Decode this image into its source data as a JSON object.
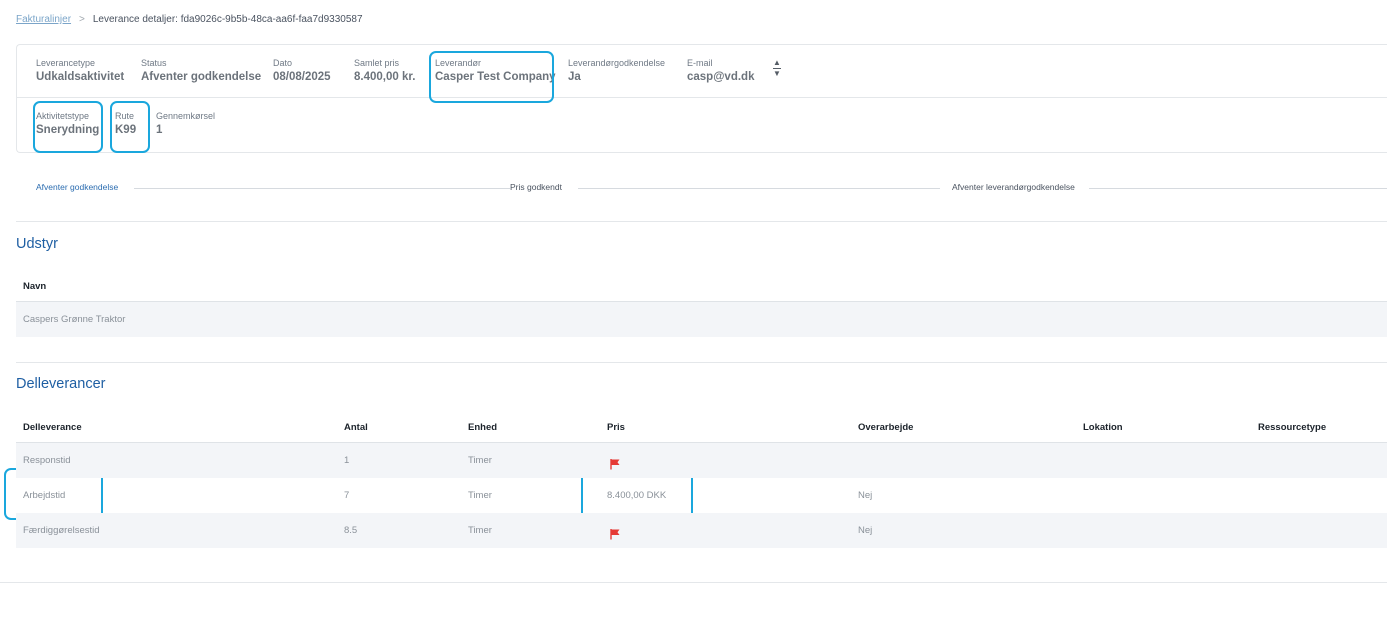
{
  "breadcrumb": {
    "link": "Fakturalinjer",
    "separator": ">",
    "current": "Leverance detaljer: fda9026c-9b5b-48ca-aa6f-faa7d9330587"
  },
  "info": {
    "leverancetype": {
      "label": "Leverancetype",
      "value": "Udkaldsaktivitet"
    },
    "status": {
      "label": "Status",
      "value": "Afventer godkendelse"
    },
    "dato": {
      "label": "Dato",
      "value": "08/08/2025"
    },
    "samlet_pris": {
      "label": "Samlet pris",
      "value": "8.400,00 kr."
    },
    "leverandor": {
      "label": "Leverandør",
      "value": "Casper Test Company"
    },
    "leverandorgodkendelse": {
      "label": "Leverandørgodkendelse",
      "value": "Ja"
    },
    "email": {
      "label": "E-mail",
      "value": "casp@vd.dk"
    },
    "aktivitetstype": {
      "label": "Aktivitetstype",
      "value": "Snerydning"
    },
    "rute": {
      "label": "Rute",
      "value": "K99"
    },
    "gennemkorsel": {
      "label": "Gennemkørsel",
      "value": "1"
    }
  },
  "steps": [
    {
      "label": "Afventer godkendelse",
      "active": true
    },
    {
      "label": "Pris godkendt",
      "active": false
    },
    {
      "label": "Afventer leverandørgodkendelse",
      "active": false
    }
  ],
  "udstyr": {
    "title": "Udstyr",
    "column": "Navn",
    "rows": [
      "Caspers Grønne Traktor"
    ]
  },
  "delleverancer": {
    "title": "Delleverancer",
    "columns": {
      "delleverance": "Delleverance",
      "antal": "Antal",
      "enhed": "Enhed",
      "pris": "Pris",
      "overarbejde": "Overarbejde",
      "lokation": "Lokation",
      "ressourcetype": "Ressourcetype"
    },
    "rows": [
      {
        "delleverance": "Responstid",
        "antal": "1",
        "enhed": "Timer",
        "pris": "",
        "pris_icon": "red-flag-icon",
        "overarbejde": "",
        "lokation": "",
        "ressourcetype": ""
      },
      {
        "delleverance": "Arbejdstid",
        "antal": "7",
        "enhed": "Timer",
        "pris": "8.400,00 DKK",
        "pris_icon": "",
        "overarbejde": "Nej",
        "lokation": "",
        "ressourcetype": ""
      },
      {
        "delleverance": "Færdiggørelsestid",
        "antal": "8.5",
        "enhed": "Timer",
        "pris": "",
        "pris_icon": "red-flag-icon",
        "overarbejde": "Nej",
        "lokation": "",
        "ressourcetype": ""
      }
    ]
  },
  "colors": {
    "accent": "#1f5fa3",
    "highlight": "#1aa7dd",
    "flag": "#e53935"
  }
}
